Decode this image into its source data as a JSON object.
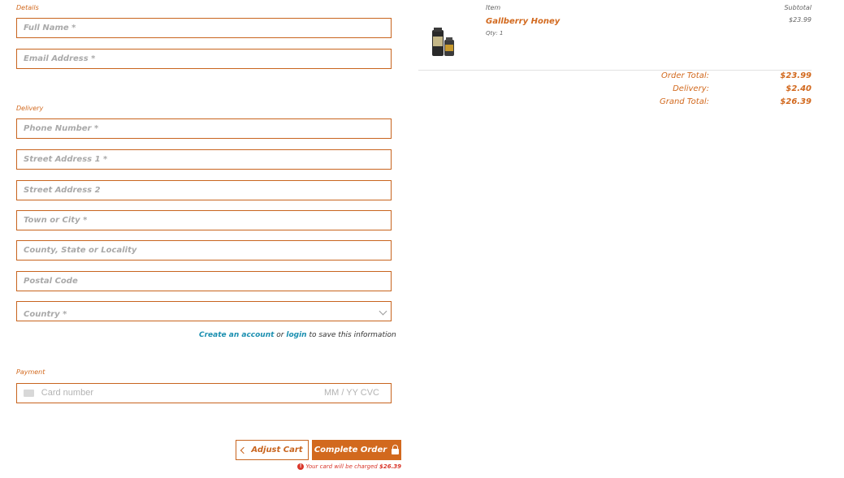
{
  "details": {
    "label": "Details",
    "full_name_placeholder": "Full Name *",
    "email_placeholder": "Email Address *"
  },
  "delivery": {
    "label": "Delivery",
    "phone_placeholder": "Phone Number *",
    "street1_placeholder": "Street Address 1 *",
    "street2_placeholder": "Street Address 2",
    "town_placeholder": "Town or City *",
    "county_placeholder": "County, State or Locality",
    "postal_placeholder": "Postal Code",
    "country_placeholder": "Country *"
  },
  "account": {
    "create_link": "Create an account",
    "or": "or",
    "login_link": "login",
    "suffix": "to save this information"
  },
  "payment": {
    "label": "Payment",
    "card_placeholder": "Card number",
    "exp_cvc": "MM / YY  CVC"
  },
  "actions": {
    "adjust_label": "Adjust Cart",
    "complete_label": "Complete Order",
    "charge_note": "Your card will be charged",
    "charge_amount": "$26.39"
  },
  "summary": {
    "item_header": "Item",
    "subtotal_header": "Subtotal",
    "item_name": "Gallberry Honey",
    "item_qty": "Qty: 1",
    "item_subtotal": "$23.99",
    "order_total_label": "Order Total:",
    "order_total": "$23.99",
    "delivery_label": "Delivery:",
    "delivery": "$2.40",
    "grand_total_label": "Grand Total:",
    "grand_total": "$26.39"
  },
  "colors": {
    "accent": "#d2691e",
    "link": "#1b8fb0",
    "error": "#d9362a"
  },
  "icons": [
    "chevron-down-icon",
    "chevron-left-icon",
    "lock-icon",
    "card-icon",
    "alert-icon"
  ]
}
